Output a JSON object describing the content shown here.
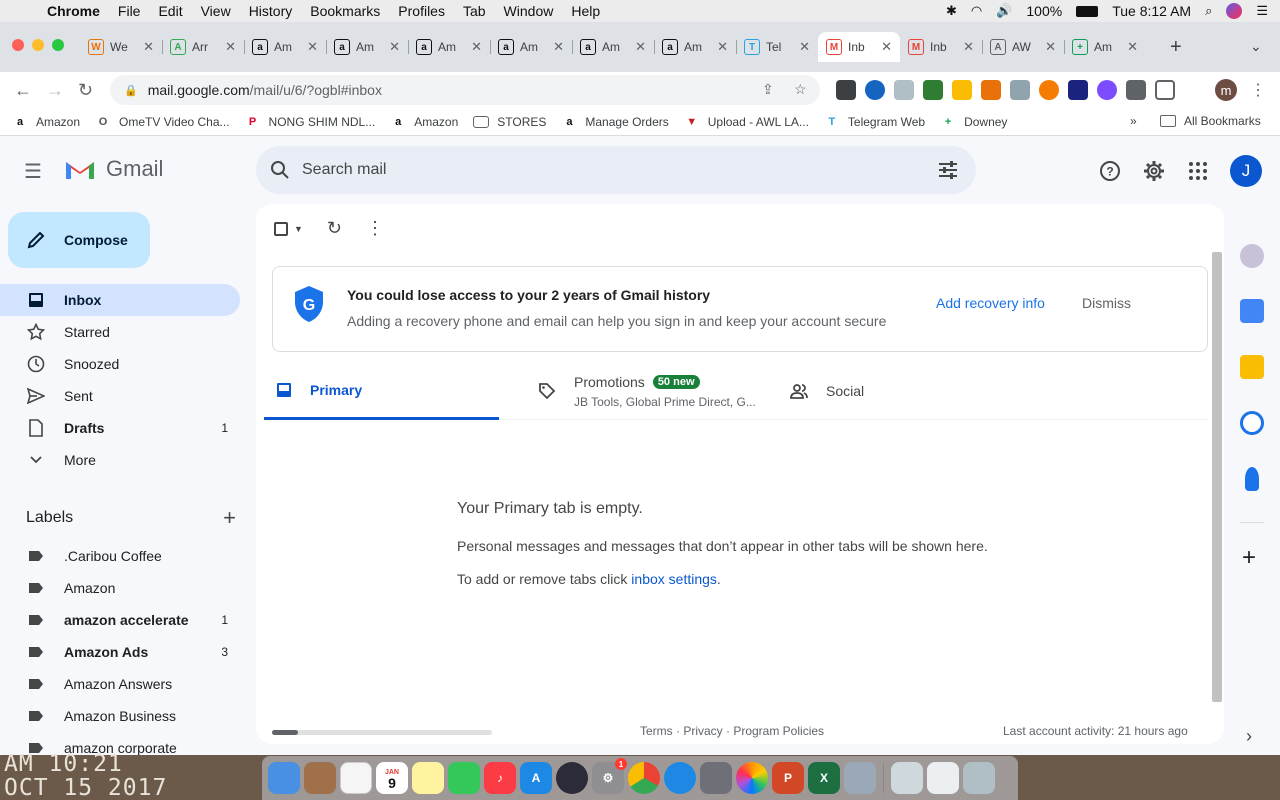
{
  "menubar": {
    "app_name": "Chrome",
    "items": [
      "File",
      "Edit",
      "View",
      "History",
      "Bookmarks",
      "Profiles",
      "Tab",
      "Window",
      "Help"
    ],
    "battery": "100%",
    "clock": "Tue 8:12 AM"
  },
  "browser": {
    "tabs": [
      {
        "title": "We",
        "icon": "W",
        "color": "#e8710a"
      },
      {
        "title": "Arr",
        "icon": "A",
        "color": "#34a853"
      },
      {
        "title": "Am",
        "icon": "a",
        "color": "#111111"
      },
      {
        "title": "Am",
        "icon": "a",
        "color": "#111111"
      },
      {
        "title": "Am",
        "icon": "a",
        "color": "#111111"
      },
      {
        "title": "Am",
        "icon": "a",
        "color": "#111111"
      },
      {
        "title": "Am",
        "icon": "a",
        "color": "#111111"
      },
      {
        "title": "Am",
        "icon": "a",
        "color": "#111111"
      },
      {
        "title": "Tel",
        "icon": "T",
        "color": "#2aa3df"
      },
      {
        "title": "Inb",
        "icon": "M",
        "color": "#ea4335",
        "active": true
      },
      {
        "title": "Inb",
        "icon": "M",
        "color": "#ea4335"
      },
      {
        "title": "AW",
        "icon": "A",
        "color": "#5f6368"
      },
      {
        "title": "Am",
        "icon": "+",
        "color": "#0f9d58"
      }
    ],
    "url_host": "mail.google.com",
    "url_path": "/mail/u/6/?ogbl#inbox",
    "profile_initial": "m",
    "bookmarks": [
      {
        "label": "Amazon",
        "icon": "a",
        "color": "#111111"
      },
      {
        "label": "OmeTV Video Cha...",
        "icon": "O",
        "color": "#555555"
      },
      {
        "label": "NONG SHIM NDL...",
        "icon": "P",
        "color": "#e60023"
      },
      {
        "label": "Amazon",
        "icon": "a",
        "color": "#111111"
      },
      {
        "label": "STORES",
        "icon": "folder",
        "color": "#5f6368"
      },
      {
        "label": "Manage Orders",
        "icon": "a",
        "color": "#111111"
      },
      {
        "label": "Upload - AWL LA...",
        "icon": "▼",
        "color": "#c5221f"
      },
      {
        "label": "Telegram Web",
        "icon": "T",
        "color": "#2aa3df"
      },
      {
        "label": "Downey",
        "icon": "+",
        "color": "#0f9d58"
      }
    ],
    "bookmarks_more": "»",
    "all_bookmarks": "All Bookmarks"
  },
  "gmail": {
    "product_name": "Gmail",
    "search_placeholder": "Search mail",
    "account_initial": "J",
    "compose_label": "Compose",
    "nav": [
      {
        "label": "Inbox",
        "icon": "inbox-icon",
        "count": "",
        "active": true
      },
      {
        "label": "Starred",
        "icon": "star-icon",
        "count": ""
      },
      {
        "label": "Snoozed",
        "icon": "clock-icon",
        "count": ""
      },
      {
        "label": "Sent",
        "icon": "send-icon",
        "count": ""
      },
      {
        "label": "Drafts",
        "icon": "draft-icon",
        "count": "1",
        "bold": true
      },
      {
        "label": "More",
        "icon": "chevron-down-icon",
        "count": ""
      }
    ],
    "labels_title": "Labels",
    "labels": [
      {
        "label": ".Caribou Coffee",
        "count": ""
      },
      {
        "label": "Amazon",
        "count": ""
      },
      {
        "label": "amazon accelerate",
        "count": "1",
        "bold": true
      },
      {
        "label": "Amazon Ads",
        "count": "3",
        "bold": true
      },
      {
        "label": "Amazon Answers",
        "count": ""
      },
      {
        "label": "Amazon Business",
        "count": ""
      },
      {
        "label": "amazon corporate",
        "count": ""
      }
    ],
    "banner": {
      "title": "You could lose access to your 2 years of Gmail history",
      "description": "Adding a recovery phone and email can help you sign in and keep your account secure",
      "primary_action": "Add recovery info",
      "secondary_action": "Dismiss"
    },
    "category_tabs": {
      "primary": "Primary",
      "promotions": "Promotions",
      "promotions_badge": "50 new",
      "promotions_senders": "JB Tools, Global Prime Direct, G...",
      "social": "Social"
    },
    "empty_state": {
      "heading": "Your Primary tab is empty.",
      "body": "Personal messages and messages that don’t appear in other tabs will be shown here.",
      "settings_prefix": "To add or remove tabs click ",
      "settings_link": "inbox settings",
      "settings_suffix": "."
    },
    "footer": {
      "links": "Terms · Privacy · Program Policies",
      "activity": "Last account activity: 21 hours ago"
    }
  },
  "desktop": {
    "timestamp_line1": "AM 10:21",
    "timestamp_line2": "OCT 15 2017"
  },
  "dock": {
    "calendar_day": "9",
    "calendar_month": "JAN",
    "settings_badge": "1"
  }
}
